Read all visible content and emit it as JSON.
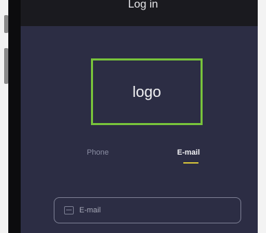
{
  "header": {
    "title": "Log in"
  },
  "logo": {
    "text": "logo",
    "border_color": "#78c33b"
  },
  "tabs": [
    {
      "label": "Phone",
      "active": false
    },
    {
      "label": "E-mail",
      "active": true
    }
  ],
  "email_input": {
    "placeholder": "E-mail",
    "value": "",
    "icon": "envelope-icon"
  },
  "colors": {
    "screen_bg": "#2c2d44",
    "header_bg": "#1a1a1f",
    "accent_underline": "#d6c43b"
  }
}
